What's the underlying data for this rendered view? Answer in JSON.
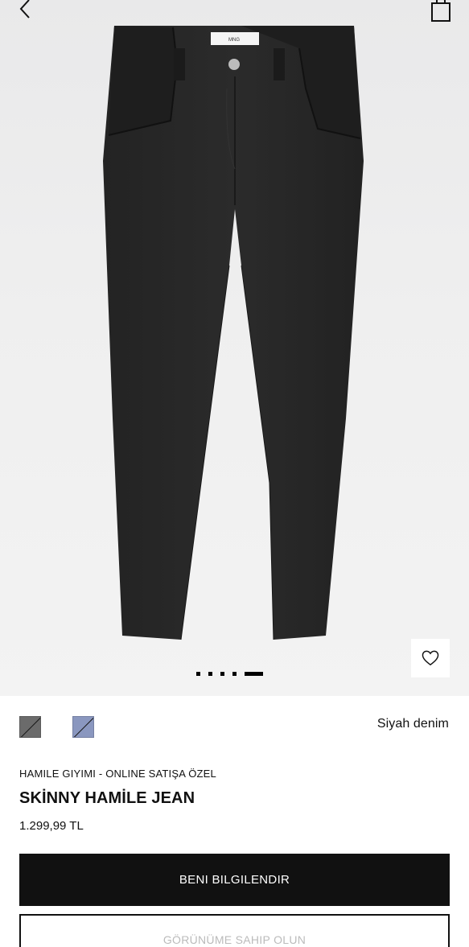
{
  "header": {
    "back_icon": "chevron-left-icon",
    "bag_icon": "shopping-bag-icon"
  },
  "product_image": {
    "label_text": "MNG",
    "carousel": {
      "total": 5,
      "active_index": 4
    }
  },
  "wishlist": {
    "icon": "heart-icon"
  },
  "colors": {
    "swatches": [
      {
        "name": "swatch-dark-grey",
        "color": "#6b6b6b",
        "unavailable": true
      },
      {
        "name": "swatch-light-blue",
        "color": "#8a97bf",
        "unavailable": true
      }
    ],
    "selected_name": "Siyah denim"
  },
  "product": {
    "category": "HAMILE GIYIMI - ONLINE SATIŞA ÖZEL",
    "title": "SKİNNY HAMİLE JEAN",
    "price": "1.299,99 TL"
  },
  "actions": {
    "notify_label": "BENI BILGILENDIR",
    "own_label": "GÖRÜNÜME SAHIP OLUN"
  }
}
